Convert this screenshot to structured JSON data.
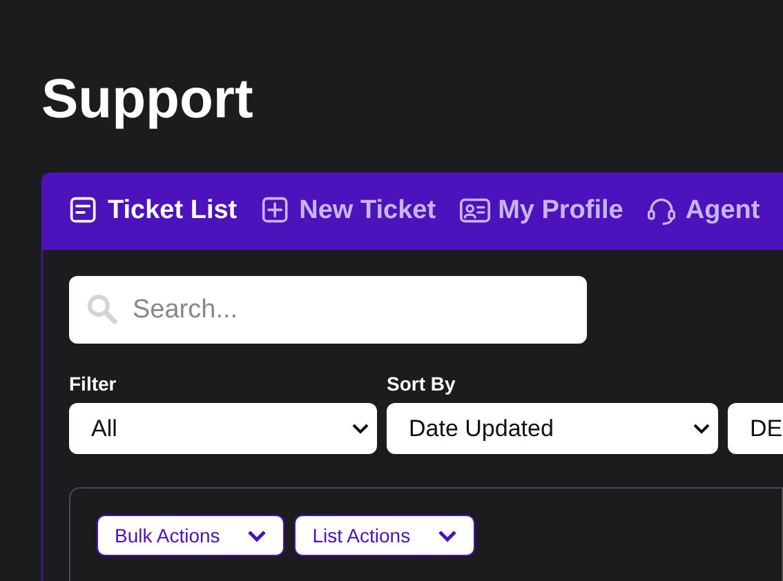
{
  "page_title": "Support",
  "tabs": [
    {
      "kind": "list",
      "label": "Ticket List",
      "selected": true
    },
    {
      "kind": "new",
      "label": "New Ticket",
      "selected": false
    },
    {
      "kind": "profile",
      "label": "My Profile",
      "selected": false
    },
    {
      "kind": "agent",
      "label": "Agent",
      "selected": false
    }
  ],
  "search": {
    "placeholder": "Search..."
  },
  "selects": [
    {
      "label": "Filter",
      "value": "All"
    },
    {
      "label": "Sort By",
      "value": "Date Updated"
    },
    {
      "value": "DE"
    }
  ],
  "action_buttons": [
    "Bulk Actions",
    "List Actions"
  ]
}
